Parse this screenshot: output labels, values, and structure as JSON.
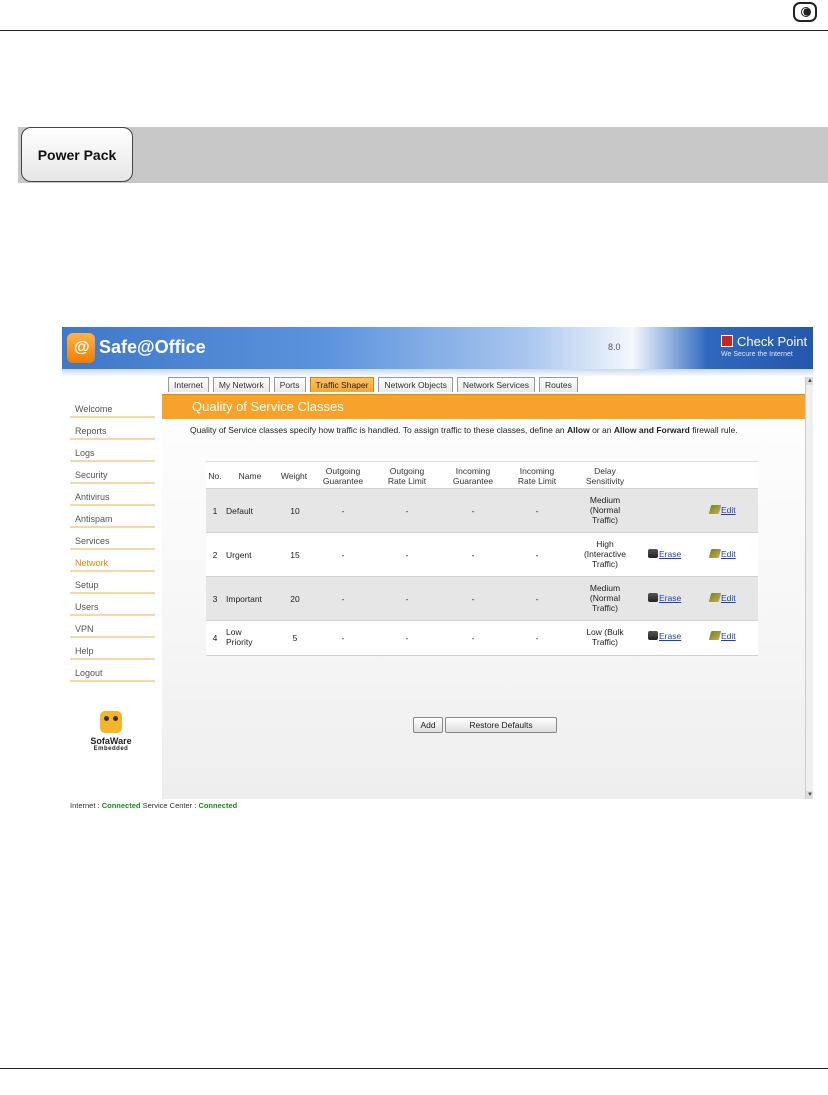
{
  "page": {
    "banner_label": "Power Pack"
  },
  "app": {
    "title": "Safe@Office",
    "version": "8.0",
    "vendor": "Check Point",
    "vendor_tagline": "We Secure the Internet"
  },
  "sidebar": {
    "items": [
      {
        "label": "Welcome"
      },
      {
        "label": "Reports"
      },
      {
        "label": "Logs"
      },
      {
        "label": "Security"
      },
      {
        "label": "Antivirus"
      },
      {
        "label": "Antispam"
      },
      {
        "label": "Services"
      },
      {
        "label": "Network"
      },
      {
        "label": "Setup"
      },
      {
        "label": "Users"
      },
      {
        "label": "VPN"
      },
      {
        "label": "Help"
      },
      {
        "label": "Logout"
      }
    ],
    "brand_name": "SofaWare",
    "brand_sub": "Embedded"
  },
  "tabs": [
    {
      "label": "Internet"
    },
    {
      "label": "My Network"
    },
    {
      "label": "Ports"
    },
    {
      "label": "Traffic Shaper"
    },
    {
      "label": "Network Objects"
    },
    {
      "label": "Network Services"
    },
    {
      "label": "Routes"
    }
  ],
  "section": {
    "title": "Quality of Service Classes",
    "desc_pre": "Quality of Service classes specify how traffic is handled. To assign traffic to these classes, define an ",
    "desc_allow": "Allow",
    "desc_mid": " or an ",
    "desc_allow_forward": "Allow and Forward",
    "desc_post": " firewall rule."
  },
  "table": {
    "headers": {
      "no": "No.",
      "name": "Name",
      "weight": "Weight",
      "og1": "Outgoing",
      "og2": "Guarantee",
      "orl1": "Outgoing",
      "orl2": "Rate Limit",
      "ig1": "Incoming",
      "ig2": "Guarantee",
      "irl1": "Incoming",
      "irl2": "Rate Limit",
      "ds1": "Delay",
      "ds2": "Sensitivity"
    },
    "rows": [
      {
        "no": "1",
        "name1": "Default",
        "name2": "",
        "weight": "10",
        "og": "-",
        "orl": "-",
        "ig": "-",
        "irl": "-",
        "ds1": "Medium",
        "ds2": "(Normal",
        "ds3": "Traffic)",
        "erase": "",
        "edit": "Edit"
      },
      {
        "no": "2",
        "name1": "Urgent",
        "name2": "",
        "weight": "15",
        "og": "-",
        "orl": "-",
        "ig": "-",
        "irl": "-",
        "ds1": "High",
        "ds2": "(Interactive",
        "ds3": "Traffic)",
        "erase": "Erase",
        "edit": "Edit"
      },
      {
        "no": "3",
        "name1": "Important",
        "name2": "",
        "weight": "20",
        "og": "-",
        "orl": "-",
        "ig": "-",
        "irl": "-",
        "ds1": "Medium",
        "ds2": "(Normal",
        "ds3": "Traffic)",
        "erase": "Erase",
        "edit": "Edit"
      },
      {
        "no": "4",
        "name1": "Low",
        "name2": "Priority",
        "weight": "5",
        "og": "-",
        "orl": "-",
        "ig": "-",
        "irl": "-",
        "ds1": "Low (Bulk",
        "ds2": "Traffic)",
        "ds3": "",
        "erase": "Erase",
        "edit": "Edit"
      }
    ]
  },
  "buttons": {
    "add": "Add",
    "restore": "Restore Defaults"
  },
  "status": {
    "internet_label": "Internet :",
    "internet_value": "Connected",
    "service_label": "Service Center :",
    "service_value": "Connected"
  }
}
